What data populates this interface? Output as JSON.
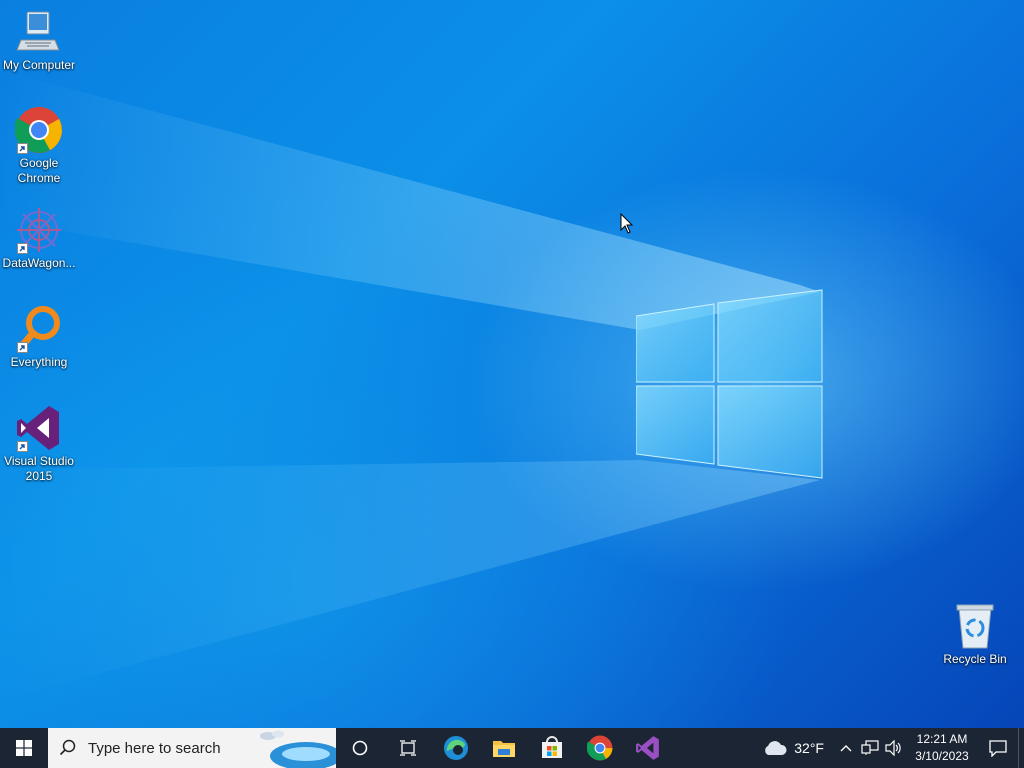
{
  "desktop": {
    "icons": [
      {
        "label": "My Computer",
        "icon": "computer-icon"
      },
      {
        "label": "Google\nChrome",
        "icon": "chrome-icon"
      },
      {
        "label": "DataWagon...",
        "icon": "datawagon-icon"
      },
      {
        "label": "Everything",
        "icon": "everything-search-icon"
      },
      {
        "label": "Visual Studio\n2015",
        "icon": "visual-studio-icon"
      }
    ],
    "recycle_bin": {
      "label": "Recycle Bin",
      "icon": "recycle-bin-icon"
    }
  },
  "taskbar": {
    "start_icon": "windows-start-icon",
    "search_placeholder": "Type here to search",
    "pinned": [
      "cortana-icon",
      "task-view-icon",
      "edge-icon",
      "file-explorer-icon",
      "microsoft-store-icon",
      "chrome-icon",
      "visual-studio-icon"
    ],
    "weather": {
      "temp": "32°F",
      "icon": "cloud-icon"
    },
    "tray_icons": [
      "chevron-up-icon",
      "network-icon",
      "volume-icon"
    ],
    "clock": {
      "time": "12:21 AM",
      "date": "3/10/2023"
    },
    "notification_icon": "action-center-icon"
  },
  "colors": {
    "accent": "#0a74dc",
    "taskbar_bg": "#1b2533"
  }
}
